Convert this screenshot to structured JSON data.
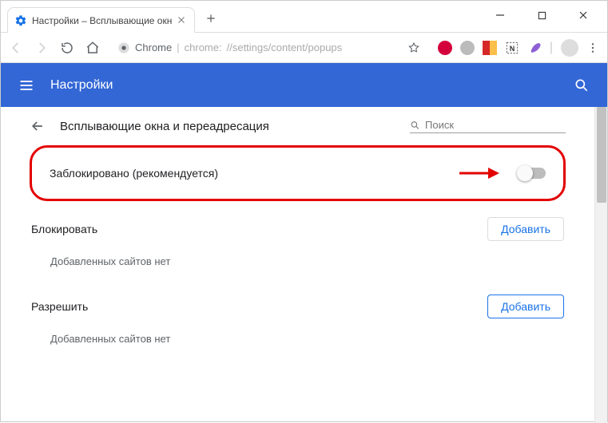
{
  "window": {
    "tab_title": "Настройки – Всплывающие окн"
  },
  "toolbar": {
    "chrome_label": "Chrome",
    "url_scheme": "chrome:",
    "url_path": "//settings/content/popups"
  },
  "header": {
    "title": "Настройки"
  },
  "subheader": {
    "title": "Всплывающие окна и переадресация",
    "search_placeholder": "Поиск"
  },
  "main_toggle": {
    "label": "Заблокировано (рекомендуется)"
  },
  "sections": {
    "block": {
      "title": "Блокировать",
      "add_label": "Добавить",
      "empty_msg": "Добавленных сайтов нет"
    },
    "allow": {
      "title": "Разрешить",
      "add_label": "Добавить",
      "empty_msg": "Добавленных сайтов нет"
    }
  }
}
